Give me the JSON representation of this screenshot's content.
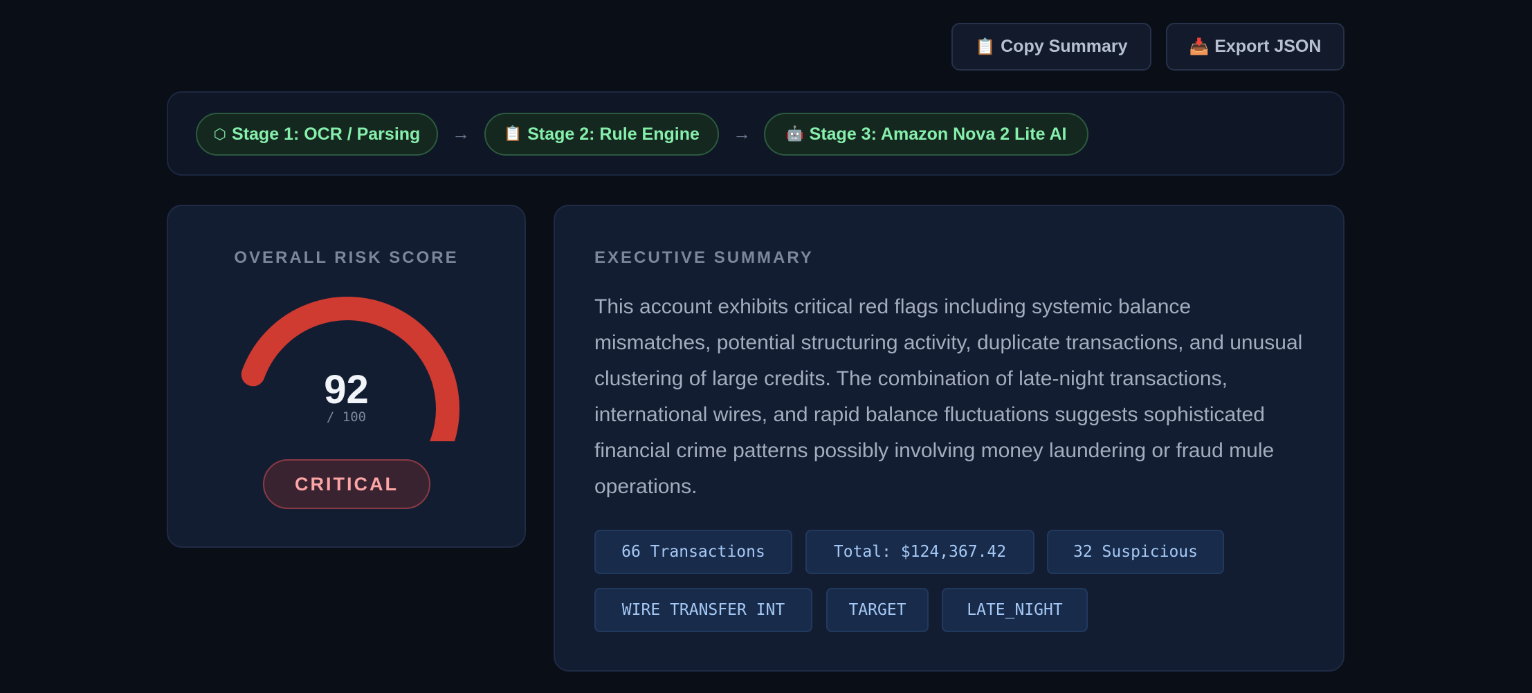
{
  "toolbar": {
    "copy_icon": "📋",
    "copy_label": "Copy Summary",
    "export_icon": "📥",
    "export_label": "Export JSON"
  },
  "pipeline": {
    "stages": [
      {
        "icon": "⬡",
        "label": "Stage 1: OCR / Parsing"
      },
      {
        "icon": "📋",
        "label": "Stage 2: Rule Engine"
      },
      {
        "icon": "🤖",
        "label": "Stage 3: Amazon Nova 2 Lite AI"
      }
    ],
    "arrow": "→"
  },
  "risk": {
    "title": "OVERALL RISK SCORE",
    "score": "92",
    "max": "/ 100",
    "fraction": 0.92,
    "level": "CRITICAL",
    "colors": {
      "arc": "#cf3a31",
      "track": "#232c3a"
    }
  },
  "summary": {
    "title": "EXECUTIVE SUMMARY",
    "text": "This account exhibits critical red flags including systemic balance mismatches, potential structuring activity, duplicate transactions, and unusual clustering of large credits. The combination of late-night transactions, international wires, and rapid balance fluctuations suggests sophisticated financial crime patterns possibly involving money laundering or fraud mule operations.",
    "tags": [
      "66 Transactions",
      "Total: $124,367.42",
      "32 Suspicious",
      "WIRE TRANSFER INT",
      "TARGET",
      "LATE_NIGHT"
    ]
  }
}
